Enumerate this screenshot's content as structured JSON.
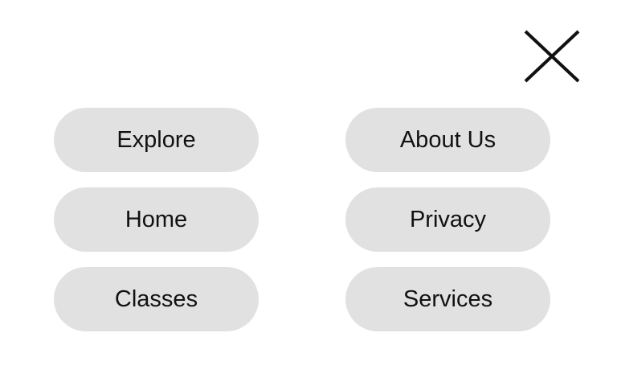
{
  "close": {
    "icon": "close-icon",
    "color": "#111111"
  },
  "menu": {
    "items": [
      {
        "label": "Explore"
      },
      {
        "label": "About Us"
      },
      {
        "label": "Home"
      },
      {
        "label": "Privacy"
      },
      {
        "label": "Classes"
      },
      {
        "label": "Services"
      }
    ]
  },
  "colors": {
    "background": "#ffffff",
    "pill": "#e1e1e1",
    "text": "#111111"
  }
}
